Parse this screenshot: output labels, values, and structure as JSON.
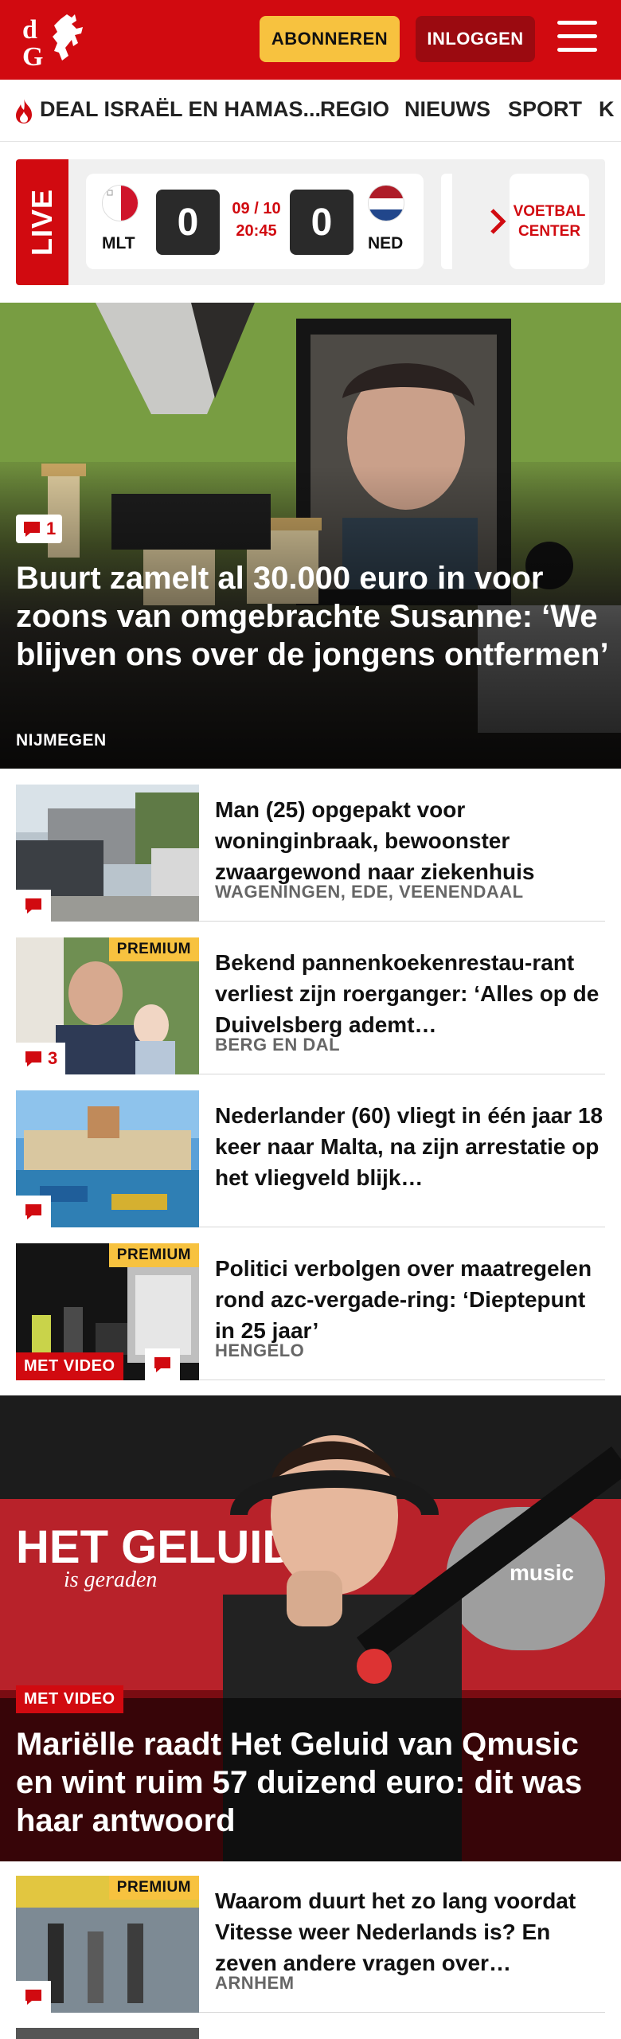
{
  "header": {
    "logo_text": "dG",
    "subscribe_label": "ABONNEREN",
    "login_label": "INLOGGEN"
  },
  "nav": {
    "items": [
      {
        "label": "DEAL ISRAËL EN HAMAS..."
      },
      {
        "label": "REGIO"
      },
      {
        "label": "NIEUWS"
      },
      {
        "label": "SPORT"
      },
      {
        "label": "K"
      }
    ]
  },
  "live": {
    "label": "LIVE",
    "home_team": "MLT",
    "away_team": "NED",
    "home_score": "0",
    "away_score": "0",
    "date": "09 / 10",
    "time": "20:45",
    "voetbal_center": "VOETBAL CENTER"
  },
  "hero": {
    "comments": "1",
    "title": "Buurt zamelt al 30.000 euro in voor zoons van omgebrachte Susanne: ‘We blijven ons over de jongens ontfermen’",
    "location": "NIJMEGEN"
  },
  "articles": [
    {
      "title": "Man (25) opgepakt voor woninginbraak, bewoonster zwaargewond naar ziekenhuis",
      "location": "WAGENINGEN, EDE, VEENENDAAL",
      "premium": "",
      "comments": "",
      "video": ""
    },
    {
      "title": "Bekend pannenkoekenrestau-rant verliest zijn roerganger: ‘Alles op de Duivelsberg ademt…",
      "location": "BERG EN DAL",
      "premium": "PREMIUM",
      "comments": "3",
      "video": ""
    },
    {
      "title": "Nederlander (60) vliegt in één jaar 18 keer naar Malta, na zijn arrestatie op het vliegveld blijk…",
      "location": "",
      "premium": "",
      "comments": "",
      "video": ""
    },
    {
      "title": "Politici verbolgen over maatregelen rond azc-vergade-ring: ‘Dieptepunt in 25 jaar’",
      "location": "HENGELO",
      "premium": "PREMIUM",
      "comments": "",
      "video": "MET VIDEO"
    }
  ],
  "video_hero": {
    "tag": "MET VIDEO",
    "title": "Mariëlle raadt Het Geluid van Qmusic en wint ruim 57 duizend euro: dit was haar antwoord",
    "bg_text_1": "HET GELUID",
    "bg_text_2": "is geraden",
    "bg_logo": "music"
  },
  "bottom_article": {
    "title": "Waarom duurt het zo lang voordat Vitesse weer Nederlands is? En zeven andere vragen over…",
    "location": "ARNHEM",
    "premium": "PREMIUM"
  },
  "colors": {
    "brand_red": "#d10a10",
    "premium_yellow": "#f7c23f",
    "login_dark_red": "#9b0a10"
  }
}
